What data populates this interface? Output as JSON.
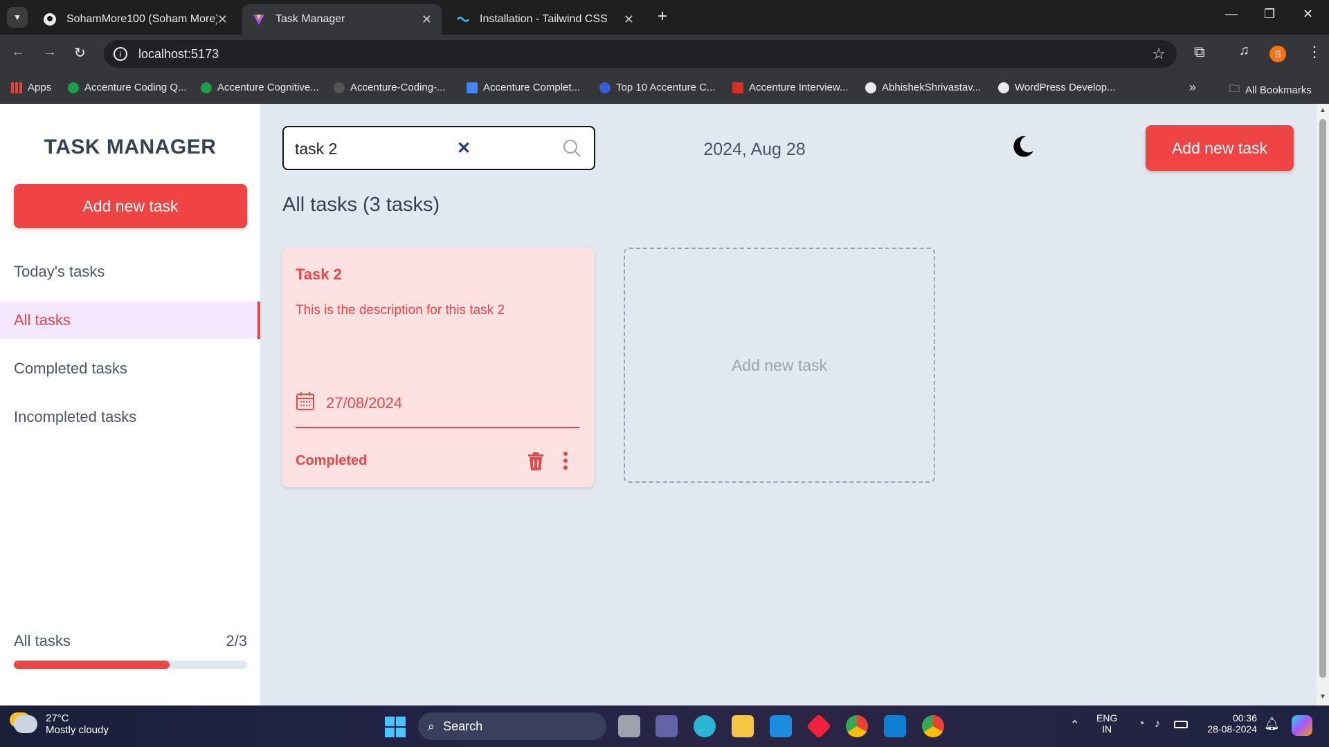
{
  "browser": {
    "tabs": [
      {
        "title": "SohamMore100 (Soham More)"
      },
      {
        "title": "Task Manager"
      },
      {
        "title": "Installation - Tailwind CSS"
      }
    ],
    "url": "localhost:5173",
    "profile_initial": "S",
    "bookmarks": [
      {
        "label": "Apps",
        "color": "#f4b400"
      },
      {
        "label": "Accenture Coding Q...",
        "color": "#1e9e4a"
      },
      {
        "label": "Accenture Cognitive...",
        "color": "#1e9e4a"
      },
      {
        "label": "Accenture-Coding-...",
        "color": "#444"
      },
      {
        "label": "Accenture Complet...",
        "color": "#4285f4"
      },
      {
        "label": "Top 10 Accenture C...",
        "color": "#3b5bdb"
      },
      {
        "label": "Accenture Interview...",
        "color": "#d93025"
      },
      {
        "label": "AbhishekShrivastav...",
        "color": "#222"
      },
      {
        "label": "WordPress Develop...",
        "color": "#111"
      }
    ],
    "all_bookmarks": "All Bookmarks"
  },
  "app": {
    "title": "TASK MANAGER",
    "add_button": "Add new task",
    "nav": [
      {
        "label": "Today's tasks"
      },
      {
        "label": "All tasks"
      },
      {
        "label": "Completed tasks"
      },
      {
        "label": "Incompleted tasks"
      }
    ],
    "progress": {
      "label": "All tasks",
      "count": "2/3",
      "fraction": 0.667
    },
    "search_value": "task 2",
    "date": "2024, Aug 28",
    "heading": "All tasks (3 tasks)",
    "task": {
      "title": "Task 2",
      "description": "This is the description for this task 2",
      "date": "27/08/2024",
      "status": "Completed"
    },
    "new_task_placeholder": "Add new task"
  },
  "taskbar": {
    "weather_temp": "27°C",
    "weather_desc": "Mostly cloudy",
    "search": "Search",
    "lang1": "ENG",
    "lang2": "IN",
    "time": "00:36",
    "date": "28-08-2024"
  }
}
